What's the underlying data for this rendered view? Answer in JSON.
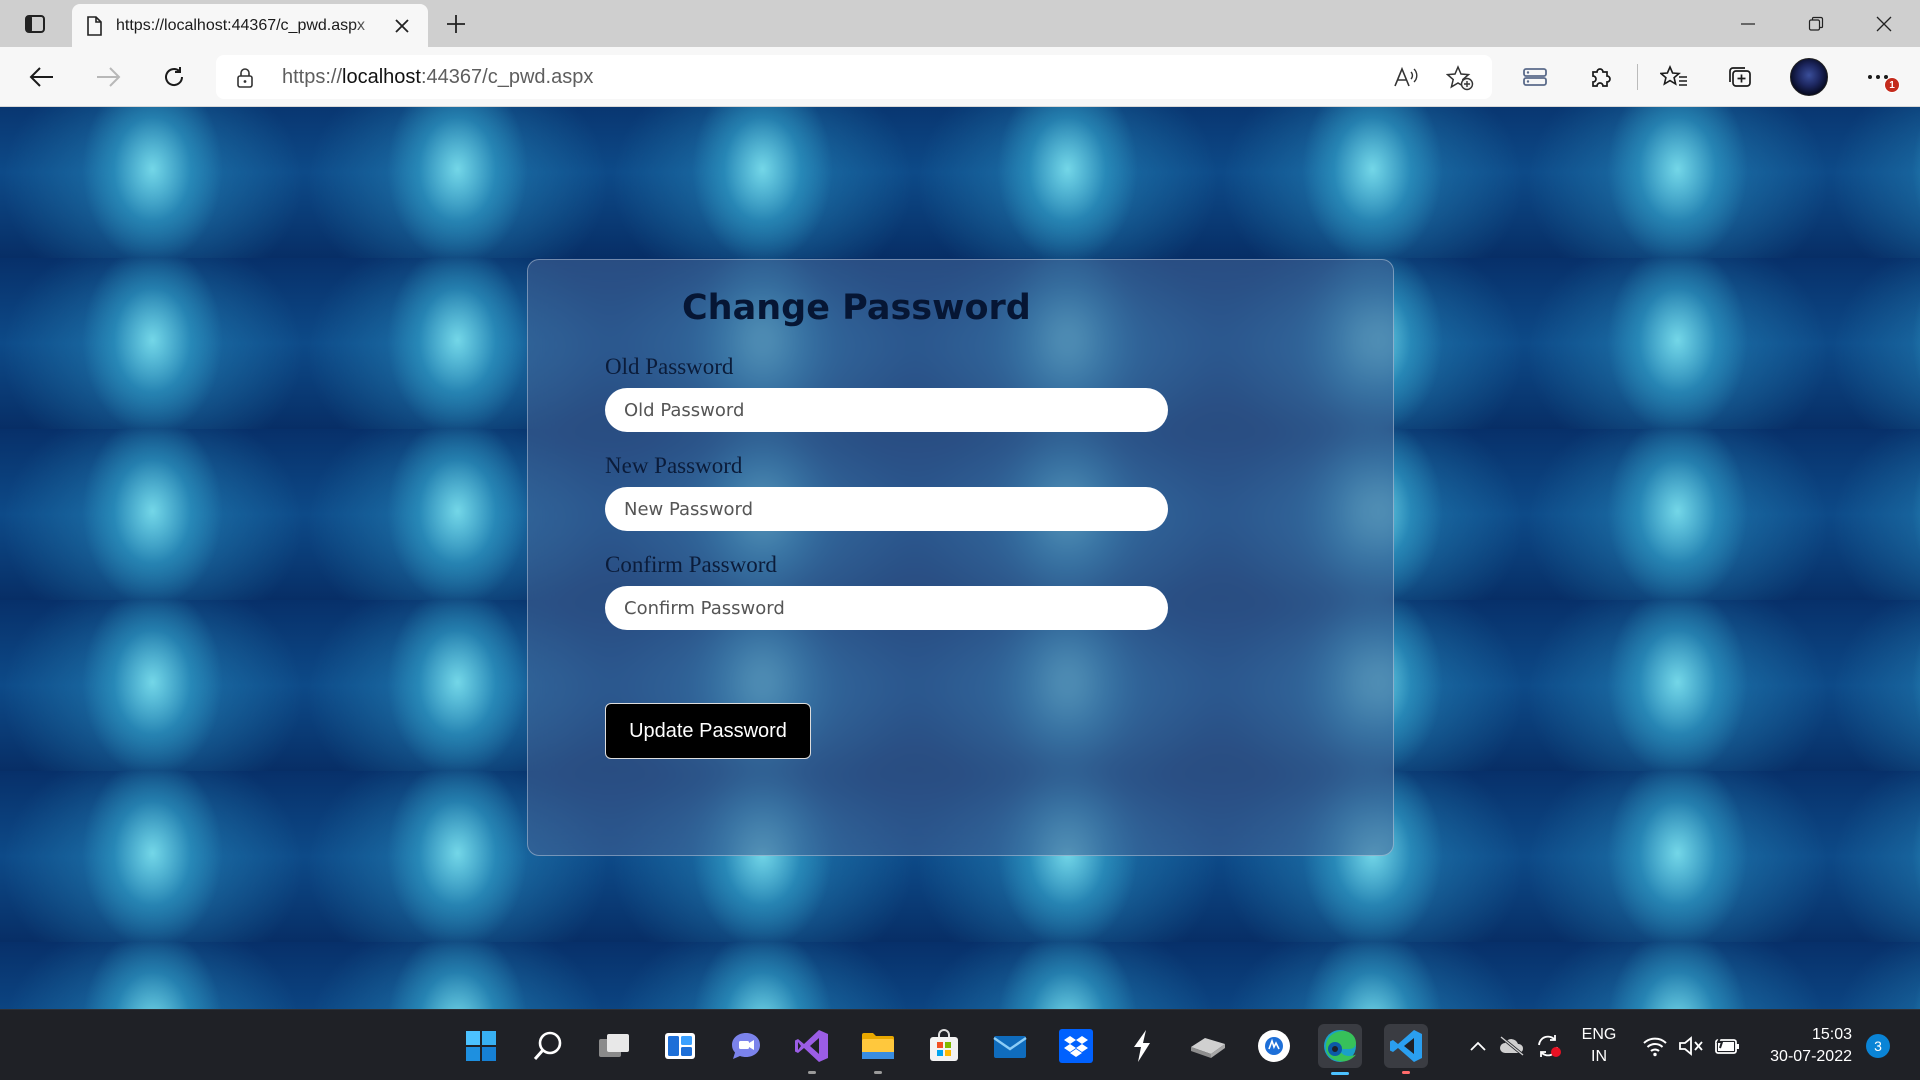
{
  "browser": {
    "tab_title": "https://localhost:44367/c_pwd.aspx",
    "url_prefix": "https://",
    "url_host": "localhost",
    "url_rest": ":44367/c_pwd.aspx",
    "notification_badge": "1"
  },
  "page": {
    "title": "Change Password",
    "fields": [
      {
        "label": "Old Password",
        "placeholder": "Old Password",
        "value": ""
      },
      {
        "label": "New Password",
        "placeholder": "New Password",
        "value": ""
      },
      {
        "label": "Confirm Password",
        "placeholder": "Confirm Password",
        "value": ""
      }
    ],
    "submit_label": "Update Password"
  },
  "taskbar": {
    "apps": [
      "start-icon",
      "search-icon",
      "task-view-icon",
      "widgets-icon",
      "chat-icon",
      "visual-studio-icon",
      "file-explorer-icon",
      "microsoft-store-icon",
      "mail-icon",
      "dropbox-icon",
      "app-icon",
      "drive-icon",
      "app-circle-icon",
      "edge-icon",
      "vscode-icon"
    ],
    "language_line1": "ENG",
    "language_line2": "IN",
    "time": "15:03",
    "date": "30-07-2022",
    "notification_count": "3"
  },
  "colors": {
    "accent": "#0a84d6",
    "button_bg": "#000000",
    "badge_red": "#c42b1c"
  }
}
